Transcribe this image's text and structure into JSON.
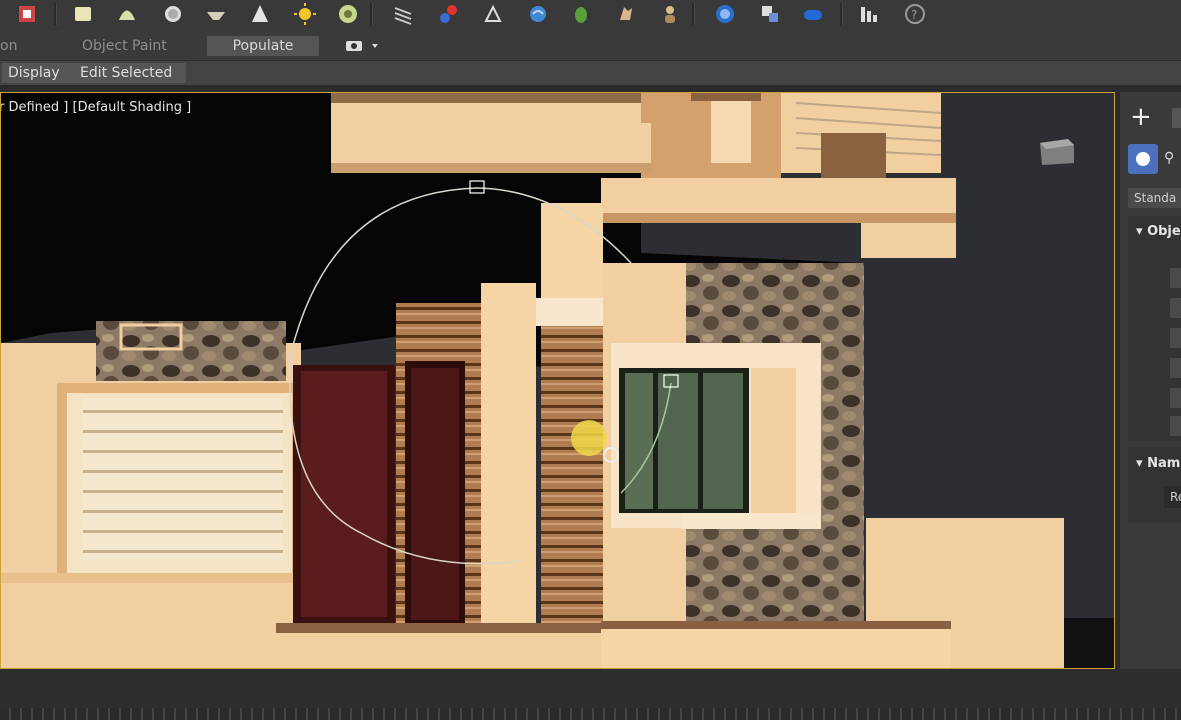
{
  "toolbar": {
    "icons": [
      "scene-icon",
      "box-icon",
      "sphere-light-icon",
      "circle-icon",
      "bowl-icon",
      "spot-light-icon",
      "sun-icon",
      "target-icon",
      "grid-lines-icon",
      "paint-icon",
      "render-setup-icon",
      "material-icon",
      "plant-icon",
      "hand-tool-icon",
      "person-icon",
      "globe-icon",
      "link-icon",
      "capsule-icon",
      "stats-icon",
      "help-icon"
    ]
  },
  "ribbon": {
    "tabs": [
      {
        "label": "on",
        "active": false
      },
      {
        "label": "Object Paint",
        "active": false
      },
      {
        "label": "Populate",
        "active": true
      }
    ]
  },
  "subrow": {
    "display_label": "Display",
    "edit_selected_label": "Edit Selected"
  },
  "viewport": {
    "label": "er Defined ] [Default Shading ]"
  },
  "command_panel": {
    "plus_label": "+",
    "dropdown_value": "Standa",
    "rollout_object": "Obje",
    "rollout_name": "Nam",
    "name_field": "Re"
  },
  "colors": {
    "accent": "#c8a43a",
    "wall": "#f2cfa0",
    "door": "#4a1414",
    "window_glass": "#52664f",
    "stone": "#6b5c4e",
    "geometry_button": "#4c6fbe"
  }
}
